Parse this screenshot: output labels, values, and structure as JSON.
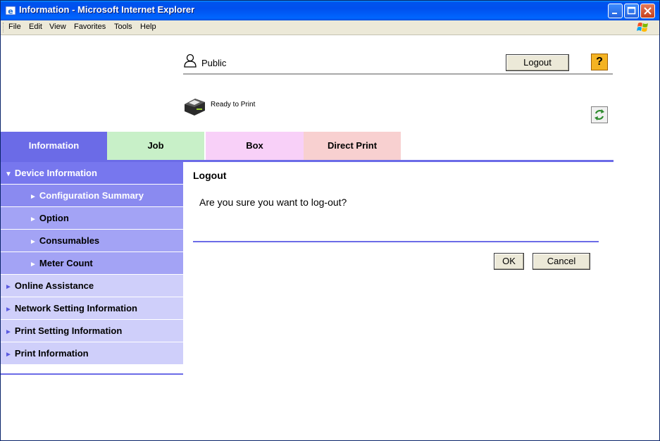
{
  "window": {
    "title": "Information - Microsoft Internet Explorer"
  },
  "menu": {
    "items": [
      "File",
      "Edit",
      "View",
      "Favorites",
      "Tools",
      "Help"
    ]
  },
  "header": {
    "user_label": "Public",
    "logout_label": "Logout",
    "help_glyph": "?",
    "status_text": "Ready to Print"
  },
  "tabs": [
    {
      "label": "Information",
      "color": "#6b6be7",
      "text_color": "#ffffff"
    },
    {
      "label": "Job",
      "color": "#c8f0c8",
      "text_color": "#000000"
    },
    {
      "label": "",
      "color": "#ffffff",
      "text_color": "#000000"
    },
    {
      "label": "Box",
      "color": "#f8d0f8",
      "text_color": "#000000"
    },
    {
      "label": "Direct Print",
      "color": "#f8d0d0",
      "text_color": "#000000"
    }
  ],
  "sidebar": {
    "items": [
      {
        "label": "Device Information",
        "arrow": "▼",
        "level": 0,
        "bg": "#7777ee",
        "color": "#ffffff",
        "arrow_color": "#ffffff"
      },
      {
        "label": "Configuration Summary",
        "arrow": "►",
        "level": 1,
        "bg": "#8a8af0",
        "color": "#ffffff",
        "arrow_color": "#ffffff"
      },
      {
        "label": "Option",
        "arrow": "►",
        "level": 1,
        "bg": "#a3a3f5",
        "color": "#000000",
        "arrow_color": "#ffffff"
      },
      {
        "label": "Consumables",
        "arrow": "►",
        "level": 1,
        "bg": "#a3a3f5",
        "color": "#000000",
        "arrow_color": "#ffffff"
      },
      {
        "label": "Meter Count",
        "arrow": "►",
        "level": 1,
        "bg": "#a3a3f5",
        "color": "#000000",
        "arrow_color": "#ffffff"
      },
      {
        "label": "Online Assistance",
        "arrow": "►",
        "level": 0,
        "bg": "#cfcffa",
        "color": "#000000",
        "arrow_color": "#5a5ae0"
      },
      {
        "label": "Network Setting Information",
        "arrow": "►",
        "level": 0,
        "bg": "#cfcffa",
        "color": "#000000",
        "arrow_color": "#5a5ae0"
      },
      {
        "label": "Print Setting Information",
        "arrow": "►",
        "level": 0,
        "bg": "#cfcffa",
        "color": "#000000",
        "arrow_color": "#5a5ae0"
      },
      {
        "label": "Print Information",
        "arrow": "►",
        "level": 0,
        "bg": "#cfcffa",
        "color": "#000000",
        "arrow_color": "#5a5ae0"
      }
    ]
  },
  "main": {
    "title": "Logout",
    "message": "Are you sure you want to log-out?",
    "ok_label": "OK",
    "cancel_label": "Cancel"
  }
}
